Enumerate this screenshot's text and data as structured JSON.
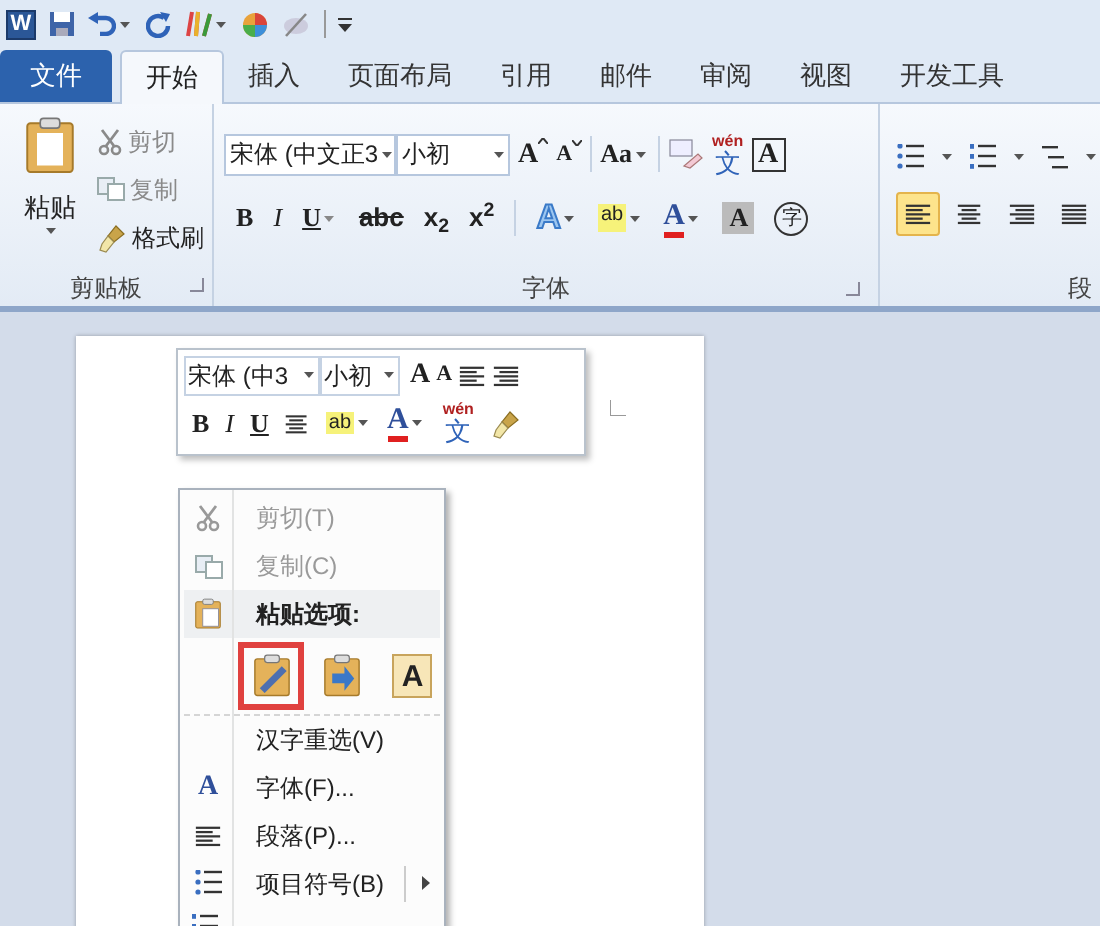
{
  "quick_access": {
    "logo": "W"
  },
  "tabs": [
    {
      "label": "文件",
      "kind": "file",
      "selected": false
    },
    {
      "label": "开始",
      "kind": "tab",
      "selected": true
    },
    {
      "label": "插入",
      "kind": "tab",
      "selected": false
    },
    {
      "label": "页面布局",
      "kind": "tab",
      "selected": false
    },
    {
      "label": "引用",
      "kind": "tab",
      "selected": false
    },
    {
      "label": "邮件",
      "kind": "tab",
      "selected": false
    },
    {
      "label": "审阅",
      "kind": "tab",
      "selected": false
    },
    {
      "label": "视图",
      "kind": "tab",
      "selected": false
    },
    {
      "label": "开发工具",
      "kind": "tab",
      "selected": false
    }
  ],
  "clipboard": {
    "paste": "粘贴",
    "items": [
      {
        "label": "剪切",
        "kind": "cut"
      },
      {
        "label": "复制",
        "kind": "copy"
      },
      {
        "label": "格式刷",
        "kind": "brush"
      }
    ],
    "label": "剪贴板"
  },
  "font": {
    "font_name": "宋体 (中文正3",
    "font_size": "小初",
    "grow": "A",
    "shrink": "A",
    "change_case": "Aa",
    "phonetic_top": "wén",
    "phonetic": "文",
    "border_char": "A",
    "format": [
      {
        "label": "B",
        "kind": "bold"
      },
      {
        "label": "I",
        "kind": "italic"
      },
      {
        "label": "U",
        "kind": "underline"
      },
      {
        "label": "abc",
        "kind": "strike"
      },
      {
        "label": "x$_{2}$",
        "kind": "sub"
      },
      {
        "label": "x$^{2}$",
        "kind": "sup"
      }
    ],
    "effects": "A",
    "highlight": "ab",
    "font_color": "A",
    "shading": "A",
    "enclosed": "字",
    "label": "字体"
  },
  "paragraph": {
    "alignments": [
      {
        "kind": "left",
        "selected": true
      },
      {
        "kind": "center",
        "selected": false
      },
      {
        "kind": "right",
        "selected": false
      },
      {
        "kind": "justify",
        "selected": false
      }
    ],
    "label": "段"
  },
  "mini_toolbar": {
    "font_name": "宋体 (中3",
    "font_size": "小初",
    "grow": "A",
    "shrink": "A",
    "format": [
      {
        "label": "B",
        "kind": "bold"
      },
      {
        "label": "I",
        "kind": "italic"
      },
      {
        "label": "U",
        "kind": "underline"
      }
    ],
    "highlight": "ab",
    "font_color": "A",
    "phonetic_top": "wén",
    "phonetic": "文"
  },
  "context_menu": [
    {
      "kind": "cut",
      "label": "剪切(T)",
      "disabled": true
    },
    {
      "kind": "copy",
      "label": "复制(C)",
      "disabled": true
    },
    {
      "kind": "paste_header",
      "label": "粘贴选项:"
    },
    {
      "kind": "paste_options",
      "options": [
        {
          "kind": "keep",
          "highlighted": true
        },
        {
          "kind": "merge",
          "highlighted": false
        },
        {
          "kind": "text",
          "label": "A",
          "highlighted": false
        }
      ]
    },
    {
      "kind": "reconvert",
      "label": "汉字重选(V)",
      "disabled": false
    },
    {
      "kind": "font",
      "icon_text": "A",
      "label": "字体(F)...",
      "disabled": false
    },
    {
      "kind": "paragraph",
      "label": "段落(P)...",
      "disabled": false
    },
    {
      "kind": "bullets",
      "label": "项目符号(B)",
      "disabled": false,
      "submenu": true
    },
    {
      "kind": "numbering_cut_off"
    }
  ]
}
